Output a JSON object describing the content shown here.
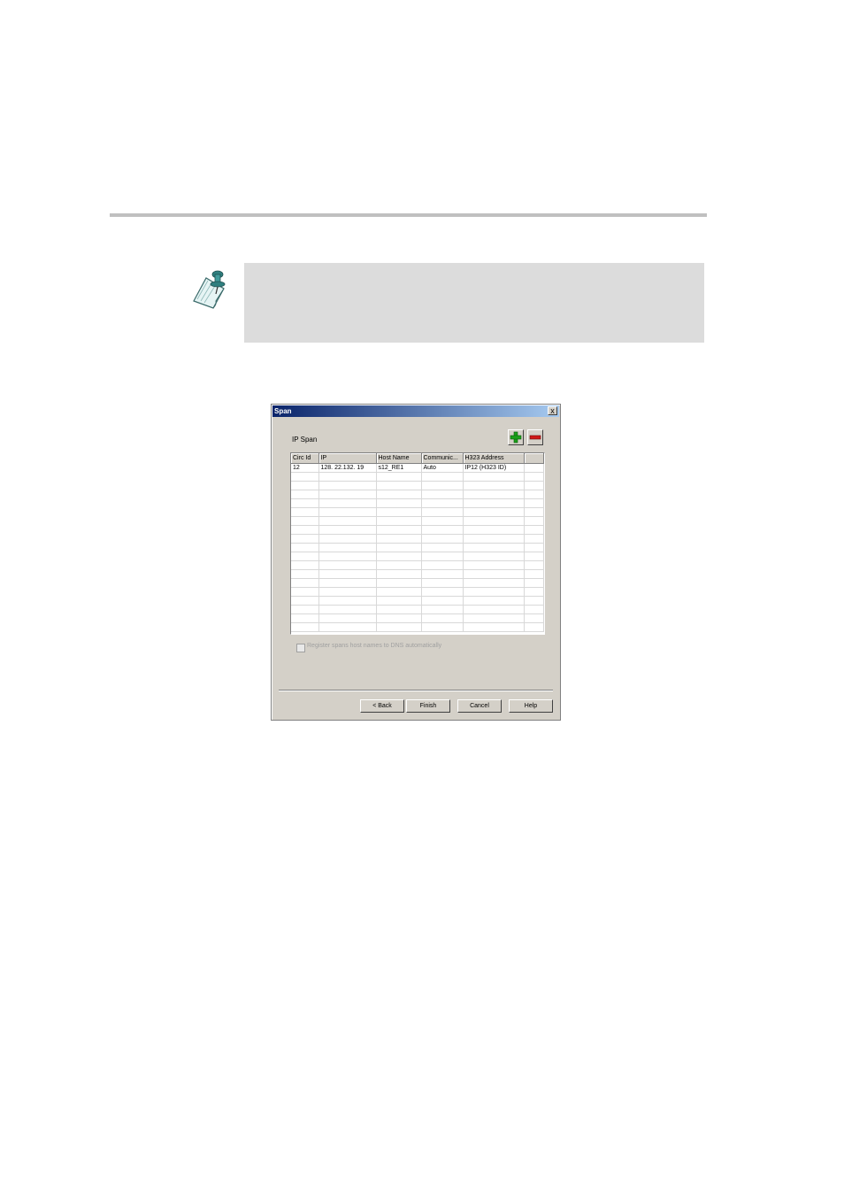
{
  "dialog": {
    "title": "Span",
    "close_label": "x",
    "section_label": "IP Span",
    "colors": {
      "titlebar_start": "#0a246a",
      "titlebar_end": "#a6caf0",
      "face": "#d4d0c8"
    },
    "toolbar": {
      "add_icon": "green-plus-icon",
      "remove_icon": "red-minus-icon"
    },
    "table": {
      "columns": [
        "Circ Id",
        "IP",
        "Host Name",
        "Communic...",
        "H323 Address",
        ""
      ],
      "rows": [
        [
          "12",
          "128. 22.132. 19",
          "s12_RE1",
          "Auto",
          "IP12 (H323 ID)",
          ""
        ]
      ]
    },
    "checkbox": {
      "label": "Register spans host names to DNS automatically",
      "checked": false
    },
    "buttons": {
      "back": "< Back",
      "finish": "Finish",
      "cancel": "Cancel",
      "help": "Help"
    }
  }
}
